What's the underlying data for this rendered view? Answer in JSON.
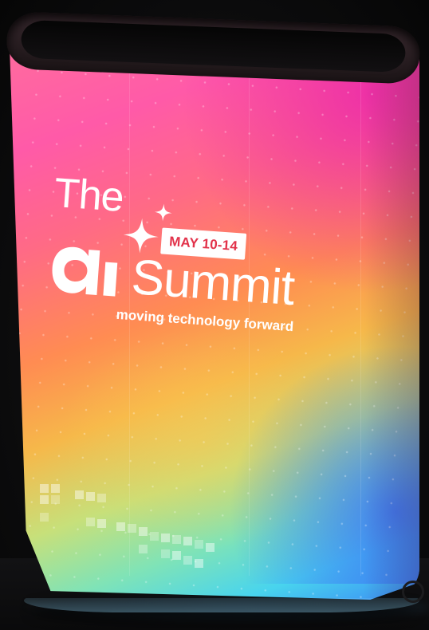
{
  "scene": {
    "subject": "illuminated-event-counter",
    "background_color": "#0b0b0c"
  },
  "colors": {
    "pink": "#ff5aa8",
    "magenta": "#eb28aa",
    "orange": "#ff8c52",
    "yellow": "#f6b84a",
    "green": "#c7e07a",
    "cyan": "#48d4ee",
    "blue": "#3b8af5",
    "badge_text": "#e2324a",
    "logo_text": "#ffffff"
  },
  "branding": {
    "the_text": "The",
    "ai_text": "ai",
    "summit_text": "Summit",
    "date_badge": "MAY 10-14",
    "tagline": "moving technology forward"
  },
  "icons": {
    "sparkles": "sparkle-stars-icon",
    "ai_mark": "ai-lettermark-icon"
  }
}
